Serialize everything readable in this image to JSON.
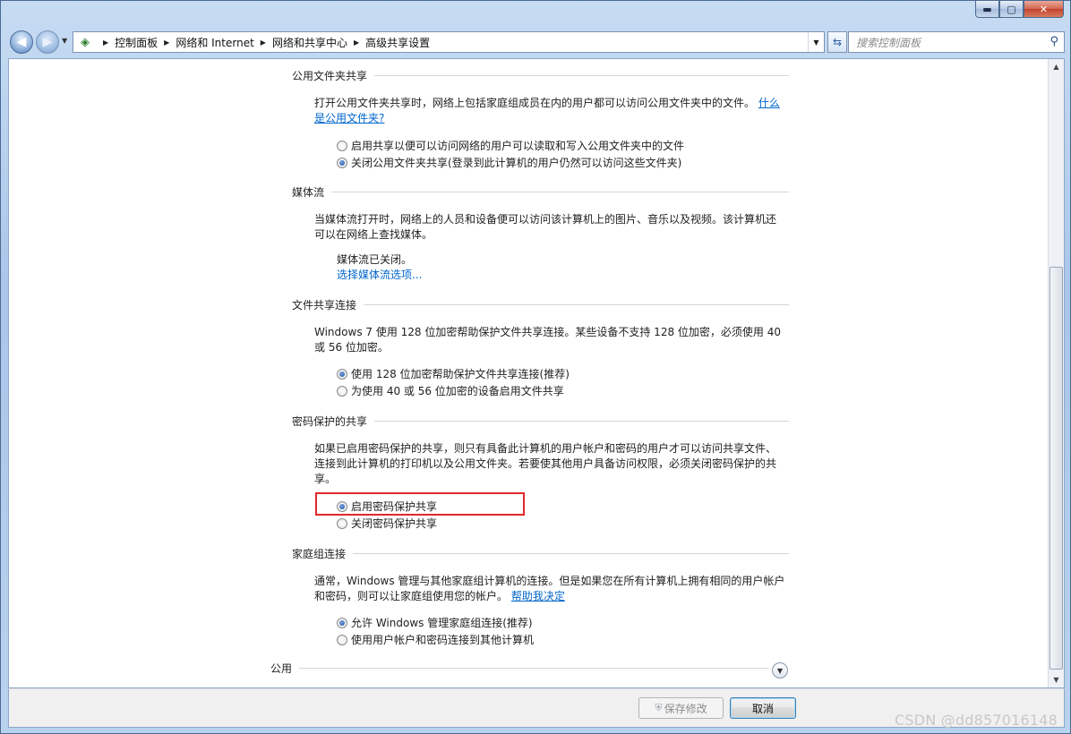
{
  "titlebar": {
    "minimize": "▬",
    "maximize": "▢",
    "close": "✕"
  },
  "navbar": {
    "breadcrumbs": [
      "控制面板",
      "网络和 Internet",
      "网络和共享中心",
      "高级共享设置"
    ],
    "search_placeholder": "搜索控制面板"
  },
  "sections": {
    "public_folder": {
      "title": "公用文件夹共享",
      "desc": "打开公用文件夹共享时，网络上包括家庭组成员在内的用户都可以访问公用文件夹中的文件。",
      "link_part1": "什么",
      "link_part2": "是公用文件夹?",
      "options": [
        "启用共享以便可以访问网络的用户可以读取和写入公用文件夹中的文件",
        "关闭公用文件夹共享(登录到此计算机的用户仍然可以访问这些文件夹)"
      ],
      "selected": 1
    },
    "media": {
      "title": "媒体流",
      "desc_line1": "当媒体流打开时，网络上的人员和设备便可以访问该计算机上的图片、音乐以及视频。该计算机还",
      "desc_line2": "可以在网络上查找媒体。",
      "status": "媒体流已关闭。",
      "link": "选择媒体流选项..."
    },
    "file_sharing": {
      "title": "文件共享连接",
      "desc_line1": "Windows 7 使用 128 位加密帮助保护文件共享连接。某些设备不支持 128 位加密，必须使用 40",
      "desc_line2": "或 56 位加密。",
      "options": [
        "使用 128 位加密帮助保护文件共享连接(推荐)",
        "为使用 40 或 56 位加密的设备启用文件共享"
      ],
      "selected": 0
    },
    "password": {
      "title": "密码保护的共享",
      "desc_line1": "如果已启用密码保护的共享，则只有具备此计算机的用户帐户和密码的用户才可以访问共享文件、",
      "desc_line2": "连接到此计算机的打印机以及公用文件夹。若要使其他用户具备访问权限，必须关闭密码保护的共",
      "desc_line3": "享。",
      "options": [
        "启用密码保护共享",
        "关闭密码保护共享"
      ],
      "selected": 0
    },
    "homegroup": {
      "title": "家庭组连接",
      "desc_line1": "通常，Windows 管理与其他家庭组计算机的连接。但是如果您在所有计算机上拥有相同的用户帐户",
      "desc_line2": "和密码，则可以让家庭组使用您的帐户。",
      "link": "帮助我决定",
      "options": [
        "允许 Windows 管理家庭组连接(推荐)",
        "使用用户帐户和密码连接到其他计算机"
      ],
      "selected": 0
    },
    "public": {
      "title": "公用"
    }
  },
  "footer": {
    "save_label": "保存修改",
    "cancel_label": "取消"
  },
  "watermark": "CSDN @dd857016148"
}
